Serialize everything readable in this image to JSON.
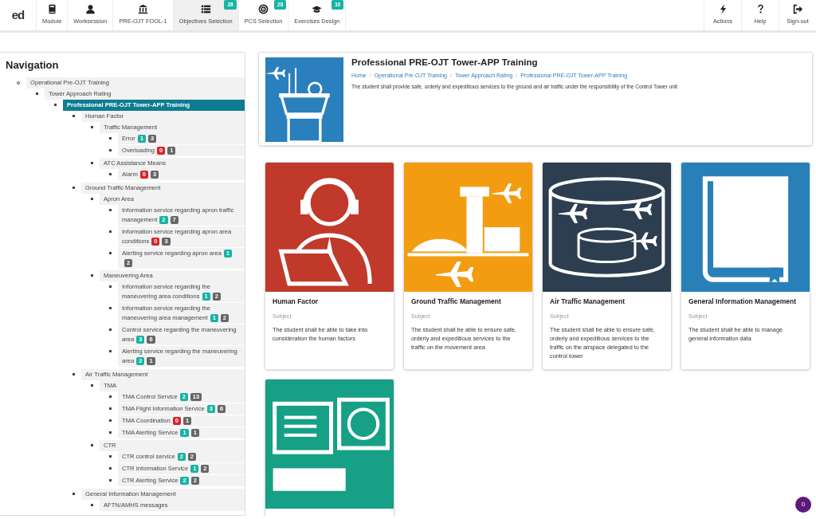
{
  "topbar": {
    "logo": "ed",
    "items": [
      {
        "kind": "book",
        "label": "Module",
        "selected": false
      },
      {
        "kind": "user",
        "label": "Worksession",
        "selected": false
      },
      {
        "kind": "bank",
        "label": "PRE-OJT FOOL-1",
        "selected": false
      },
      {
        "kind": "list",
        "label": "Objectives Selection",
        "badge": "28",
        "selected": true
      },
      {
        "kind": "target",
        "label": "PCS Selection",
        "badge": "28",
        "selected": false
      },
      {
        "kind": "cap",
        "label": "Exercises Design",
        "badge": "10",
        "selected": false
      }
    ],
    "right_items": [
      {
        "kind": "bolt",
        "label": "Actions"
      },
      {
        "kind": "question",
        "label": "Help"
      },
      {
        "kind": "signout",
        "label": "Sign-out"
      }
    ]
  },
  "navigation": {
    "title": "Navigation",
    "tree": [
      {
        "label": "Operational Pre-OJT Training",
        "selected": false,
        "children": [
          {
            "label": "Tower Approach Rating",
            "selected": false,
            "children": [
              {
                "label": "Professional PRE-OJT Tower-APP Training",
                "selected": true,
                "children": [
                  {
                    "label": "Human Factor",
                    "selected": false,
                    "children": [
                      {
                        "label": "Traffic Management",
                        "selected": false,
                        "children": [
                          {
                            "label": "Error",
                            "selected": false,
                            "badges": [
                              {
                                "text": "1",
                                "color": "#17b3a3"
                              },
                              {
                                "text": "3",
                                "color": "#666666"
                              }
                            ]
                          },
                          {
                            "label": "Overloading",
                            "selected": false,
                            "badges": [
                              {
                                "text": "0",
                                "color": "#dc2027"
                              },
                              {
                                "text": "1",
                                "color": "#666666"
                              }
                            ]
                          }
                        ]
                      },
                      {
                        "label": "ATC Assistance Means",
                        "selected": false,
                        "children": [
                          {
                            "label": "Alarm",
                            "selected": false,
                            "badges": [
                              {
                                "text": "0",
                                "color": "#dc2027"
                              },
                              {
                                "text": "3",
                                "color": "#666666"
                              }
                            ]
                          }
                        ]
                      }
                    ]
                  },
                  {
                    "label": "Ground Traffic Management",
                    "selected": false,
                    "children": [
                      {
                        "label": "Apron Area",
                        "selected": false,
                        "children": [
                          {
                            "label": "Information service regarding apron traffic management",
                            "selected": false,
                            "badges": [
                              {
                                "text": "2",
                                "color": "#17b3a3"
                              },
                              {
                                "text": "7",
                                "color": "#666666"
                              }
                            ]
                          },
                          {
                            "label": "Information service regarding apron area conditions",
                            "selected": false,
                            "badges": [
                              {
                                "text": "0",
                                "color": "#dc2027"
                              },
                              {
                                "text": "3",
                                "color": "#666666"
                              }
                            ]
                          },
                          {
                            "label": "Alerting service regarding apron area",
                            "selected": false,
                            "badges": [
                              {
                                "text": "1",
                                "color": "#17b3a3"
                              },
                              {
                                "text": "2",
                                "color": "#666666"
                              }
                            ]
                          }
                        ]
                      },
                      {
                        "label": "Maneuvering Area",
                        "selected": false,
                        "children": [
                          {
                            "label": "Information service regarding the maneuvering area conditions",
                            "selected": false,
                            "badges": [
                              {
                                "text": "1",
                                "color": "#17b3a3"
                              },
                              {
                                "text": "2",
                                "color": "#666666"
                              }
                            ]
                          },
                          {
                            "label": "Information service regarding the maneuvering area management",
                            "selected": false,
                            "badges": [
                              {
                                "text": "1",
                                "color": "#17b3a3"
                              },
                              {
                                "text": "2",
                                "color": "#666666"
                              }
                            ]
                          },
                          {
                            "label": "Control service regarding the maneuvering area",
                            "selected": false,
                            "badges": [
                              {
                                "text": "3",
                                "color": "#17b3a3"
                              },
                              {
                                "text": "6",
                                "color": "#666666"
                              }
                            ]
                          },
                          {
                            "label": "Alerting service regarding the maneuvering area",
                            "selected": false,
                            "badges": [
                              {
                                "text": "2",
                                "color": "#17b3a3"
                              },
                              {
                                "text": "1",
                                "color": "#666666"
                              }
                            ]
                          }
                        ]
                      }
                    ]
                  },
                  {
                    "label": "Air Traffic Management",
                    "selected": false,
                    "children": [
                      {
                        "label": "TMA",
                        "selected": false,
                        "children": [
                          {
                            "label": "TMA Control Service",
                            "selected": false,
                            "badges": [
                              {
                                "text": "2",
                                "color": "#17b3a3"
                              },
                              {
                                "text": "13",
                                "color": "#666666"
                              }
                            ]
                          },
                          {
                            "label": "TMA Flight Information Service",
                            "selected": false,
                            "badges": [
                              {
                                "text": "3",
                                "color": "#17b3a3"
                              },
                              {
                                "text": "6",
                                "color": "#666666"
                              }
                            ]
                          },
                          {
                            "label": "TMA Coordination",
                            "selected": false,
                            "badges": [
                              {
                                "text": "0",
                                "color": "#dc2027"
                              },
                              {
                                "text": "1",
                                "color": "#666666"
                              }
                            ]
                          },
                          {
                            "label": "TMA Alerting Service",
                            "selected": false,
                            "badges": [
                              {
                                "text": "1",
                                "color": "#17b3a3"
                              },
                              {
                                "text": "1",
                                "color": "#666666"
                              }
                            ]
                          }
                        ]
                      },
                      {
                        "label": "CTR",
                        "selected": false,
                        "children": [
                          {
                            "label": "CTR control service",
                            "selected": false,
                            "badges": [
                              {
                                "text": "2",
                                "color": "#17b3a3"
                              },
                              {
                                "text": "2",
                                "color": "#666666"
                              }
                            ]
                          },
                          {
                            "label": "CTR Information Service",
                            "selected": false,
                            "badges": [
                              {
                                "text": "1",
                                "color": "#17b3a3"
                              },
                              {
                                "text": "2",
                                "color": "#666666"
                              }
                            ]
                          },
                          {
                            "label": "CTR Alerting Service",
                            "selected": false,
                            "badges": [
                              {
                                "text": "2",
                                "color": "#17b3a3"
                              },
                              {
                                "text": "2",
                                "color": "#666666"
                              }
                            ]
                          }
                        ]
                      }
                    ]
                  },
                  {
                    "label": "General Information Management",
                    "selected": false,
                    "children": [
                      {
                        "label": "AFTN/AMHS messages",
                        "selected": false
                      }
                    ]
                  }
                ]
              }
            ]
          }
        ]
      }
    ]
  },
  "header": {
    "kind": "tower",
    "title": "Professional PRE-OJT Tower-APP Training",
    "breadcrumb_separators": [
      "/",
      "/",
      "/"
    ],
    "breadcrumb": [
      "Home",
      "Operational Pre-OJT Training",
      "Tower Approach Rating",
      "Professional PRE-OJT Tower-APP Training"
    ],
    "description": "The student shall provide safe, orderly and expeditious services to the ground and air traffic under the responsibility of the Control Tower unit"
  },
  "cards": [
    {
      "kind": "headset",
      "color": "#c0392b",
      "title": "Human Factor",
      "subtitle": "Subject",
      "description": "The student shall be able to take into consideration the human factors"
    },
    {
      "kind": "airport",
      "color": "#f39c12",
      "title": "Ground Traffic Management",
      "subtitle": "Subject",
      "description": "The student shall be able to ensure safe, orderly and expeditious services to the traffic on the movement area"
    },
    {
      "kind": "airspace",
      "color": "#2c3e50",
      "title": "Air Traffic Management",
      "subtitle": "Subject",
      "description": "The student shall be able to ensure safe, orderly and expeditious services to the traffic on the airspace delegated to the control tower"
    },
    {
      "kind": "book",
      "color": "#2980b9",
      "title": "General Information Management",
      "subtitle": "Subject",
      "description": "The student shall be able to manage general information data"
    },
    {
      "kind": "computers",
      "color": "#16a085"
    }
  ],
  "notification_badge": "0"
}
